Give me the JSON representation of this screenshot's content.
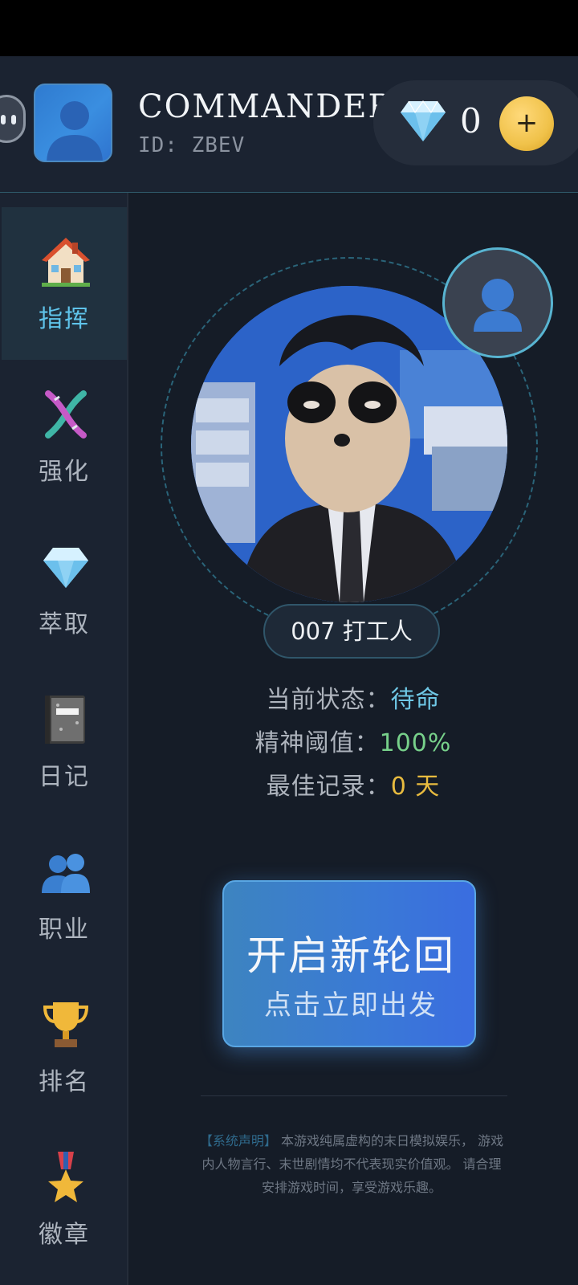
{
  "header": {
    "name": "COMMANDER",
    "id_text": "ID: ZBEV",
    "gems": "0",
    "add_label": "+"
  },
  "sidebar": {
    "items": [
      {
        "label": "指挥",
        "icon": "house-icon",
        "active": true
      },
      {
        "label": "强化",
        "icon": "dna-icon",
        "active": false
      },
      {
        "label": "萃取",
        "icon": "diamond-icon",
        "active": false
      },
      {
        "label": "日记",
        "icon": "notebook-icon",
        "active": false
      },
      {
        "label": "职业",
        "icon": "people-icon",
        "active": false
      },
      {
        "label": "排名",
        "icon": "trophy-icon",
        "active": false
      },
      {
        "label": "徽章",
        "icon": "medal-icon",
        "active": false
      }
    ]
  },
  "main": {
    "job_title": "007 打工人",
    "stats": [
      {
        "label": "当前状态：",
        "value": "待命",
        "color": "#6fc8e6"
      },
      {
        "label": "精神阈值：",
        "value": "100%",
        "color": "#77d08a"
      },
      {
        "label": "最佳记录：",
        "value": "0 天",
        "color": "#e8bb3f"
      }
    ],
    "start_title": "开启新轮回",
    "start_sub": "点击立即出发",
    "disclaimer_tag": "【系统声明】",
    "disclaimer_text": " 本游戏纯属虚构的末日模拟娱乐， 游戏内人物言行、末世剧情均不代表现实价值观。 请合理安排游戏时间，享受游戏乐趣。"
  },
  "colors": {
    "accent": "#5fc3ea",
    "background": "#151c27",
    "panel": "#1b2331",
    "gold": "#f0c24a"
  }
}
